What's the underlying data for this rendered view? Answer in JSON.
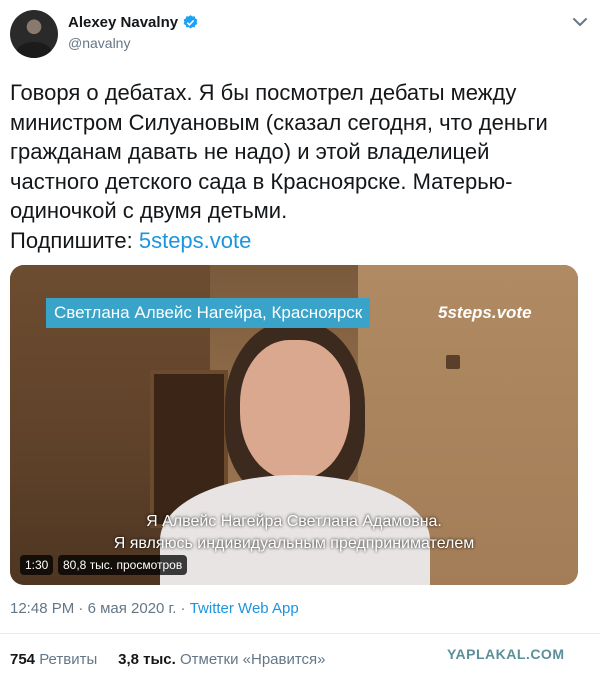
{
  "author": {
    "name": "Alexey Navalny",
    "handle": "@navalny",
    "verified_icon": "verified-badge-icon",
    "menu_icon": "chevron-down-icon"
  },
  "tweet": {
    "text": "Говоря о дебатах. Я бы посмотрел дебаты между министром Силуановым (сказал сегодня, что деньги гражданам давать не надо) и этой владелицей частного детского сада в Красноярске. Матерью-одиночкой с двумя детьми.",
    "sign_prefix": "Подпишите: ",
    "link": "5steps.vote"
  },
  "media": {
    "caption_top": "Светлана Алвейс Нагейра, Красноярск",
    "watermark": "5steps.vote",
    "subtitle_line1": "Я Алвейс Нагейра Светлана Адамовна.",
    "subtitle_line2": "Я являюсь индивидуальным предпринимателем",
    "duration": "1:30",
    "views": "80,8 тыс. просмотров"
  },
  "meta": {
    "time": "12:48 PM",
    "separator": " · ",
    "date": "6 мая 2020 г.",
    "app": "Twitter Web App"
  },
  "stats": {
    "retweets_count": "754",
    "retweets_label": "Ретвиты",
    "likes_count": "3,8 тыс.",
    "likes_label": "Отметки «Нравится»"
  },
  "site_watermark": "YAPLAKAL.COM",
  "colors": {
    "link": "#1b95e0",
    "secondary_text": "#657786",
    "caption_bg": "#3aa3c9"
  }
}
